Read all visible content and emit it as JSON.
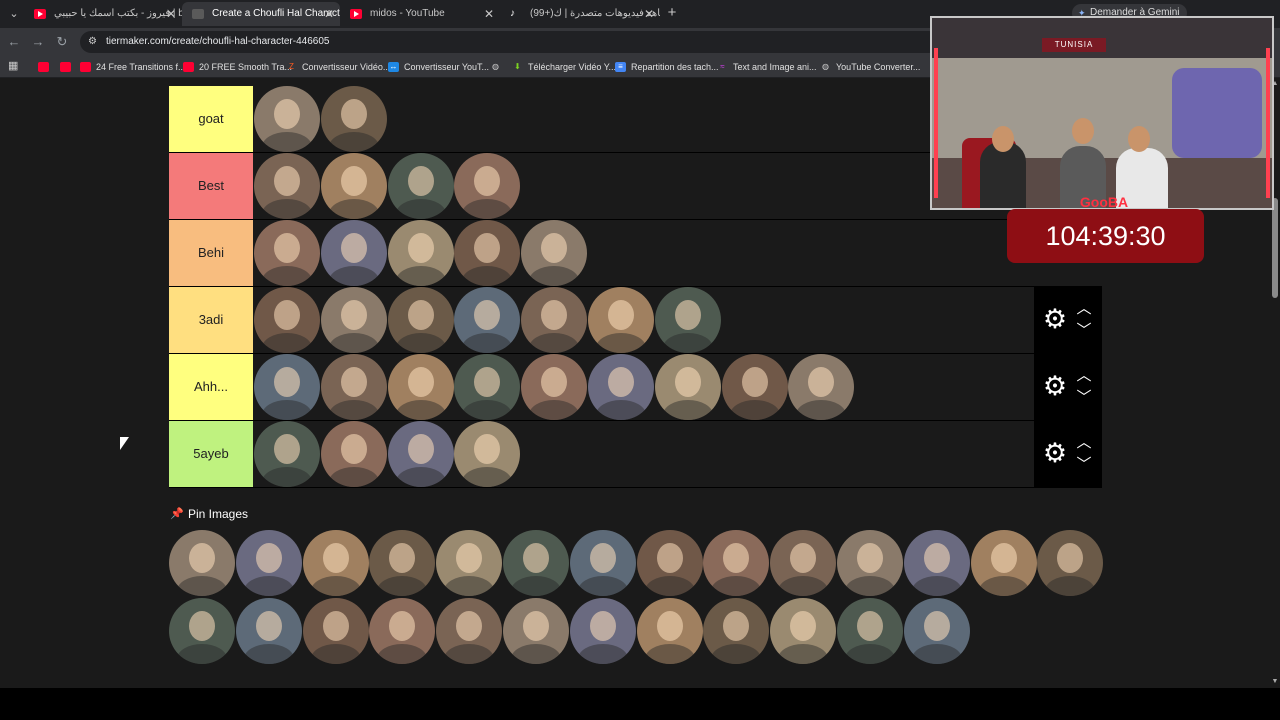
{
  "browser": {
    "tabs": [
      {
        "title": "فيروز - بكتب اسمك يا حبيبي | be",
        "favicon": "youtube-icon",
        "active": false
      },
      {
        "title": "Create a Choufli Hal Character",
        "favicon": "tiermaker-icon",
        "active": true
      },
      {
        "title": "midos - YouTube",
        "favicon": "youtube-icon",
        "active": false
      },
      {
        "title": "(99+)شاهد فيديوهات متصدرة | ك",
        "favicon": "tiktok-icon",
        "active": false
      }
    ],
    "gemini_label": "Demander à Gemini",
    "url": "tiermaker.com/create/choufli-hal-character-446605",
    "bookmarks": [
      {
        "label": "",
        "icon": "youtube-icon"
      },
      {
        "label": "",
        "icon": "youtube-icon"
      },
      {
        "label": "24 Free Transitions f...",
        "icon": "youtube-icon"
      },
      {
        "label": "20 FREE Smooth Tra...",
        "icon": "youtube-icon"
      },
      {
        "label": "Convertisseur Vidéo...",
        "icon": "z-icon"
      },
      {
        "label": "Convertisseur YouT...",
        "icon": "convert-icon"
      },
      {
        "label": "",
        "icon": "globe-icon"
      },
      {
        "label": "Télécharger Vidéo Y...",
        "icon": "download-icon"
      },
      {
        "label": "Repartition des tach...",
        "icon": "docs-icon"
      },
      {
        "label": "Text and Image ani...",
        "icon": "wave-icon"
      },
      {
        "label": "YouTube Converter...",
        "icon": "globe-icon"
      }
    ]
  },
  "tiers": [
    {
      "label": "goat",
      "color": "#ffff7f",
      "count": 2,
      "controls": false
    },
    {
      "label": "Best",
      "color": "#f47a7a",
      "count": 4,
      "controls": false
    },
    {
      "label": "Behi",
      "color": "#f8bd7f",
      "count": 5,
      "controls": false
    },
    {
      "label": "3adi",
      "color": "#ffdf80",
      "count": 7,
      "controls": true
    },
    {
      "label": "Ahh...",
      "color": "#ffff7f",
      "count": 9,
      "controls": true
    },
    {
      "label": "5ayeb",
      "color": "#bff27f",
      "count": 4,
      "controls": true
    }
  ],
  "pin": {
    "title": "Pin Images",
    "row1_count": 14,
    "row2_count": 12
  },
  "overlay": {
    "timer": "104:39:30",
    "banner": "TUNISIA",
    "logo": "GooBA"
  }
}
